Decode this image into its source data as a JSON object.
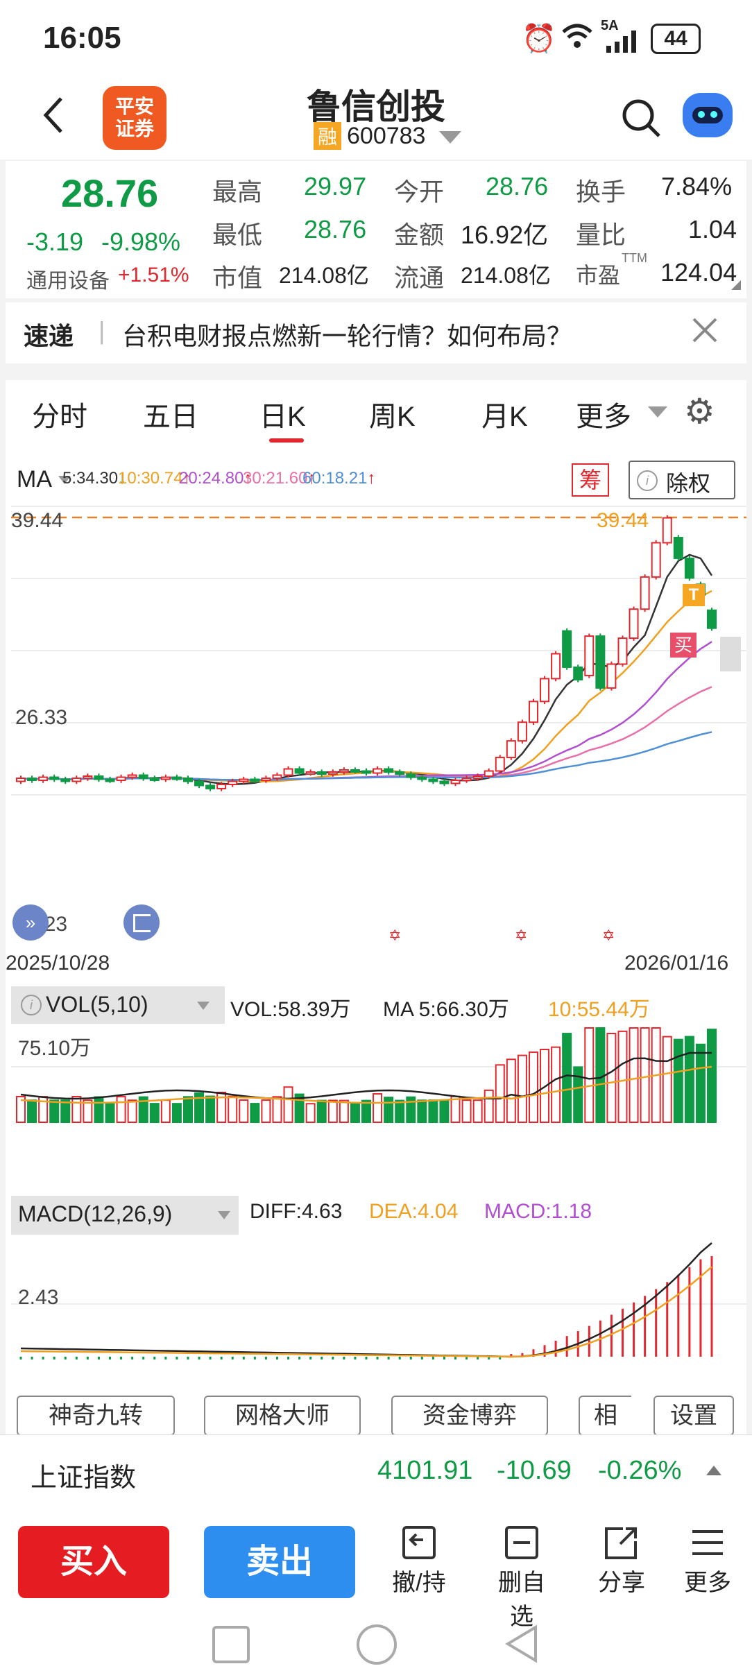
{
  "status_bar": {
    "time": "16:05",
    "battery": "44",
    "network": "5A"
  },
  "header": {
    "title": "鲁信创投",
    "logo_text_1": "平安",
    "logo_text_2": "证券",
    "badge": "融",
    "code": "600783"
  },
  "quote": {
    "price": "28.76",
    "change": "-3.19",
    "change_pct": "-9.98%",
    "sector": "通用设备",
    "sector_change": "+1.51%",
    "fields": [
      {
        "label": "最高",
        "value": "29.97"
      },
      {
        "label": "今开",
        "value": "28.76"
      },
      {
        "label": "换手",
        "value": "7.84%"
      },
      {
        "label": "最低",
        "value": "28.76"
      },
      {
        "label": "金额",
        "value": "16.92亿"
      },
      {
        "label": "量比",
        "value": "1.04"
      },
      {
        "label": "市值",
        "value": "214.08亿"
      },
      {
        "label": "流通",
        "value": "214.08亿"
      },
      {
        "label": "市盈",
        "value": "124.04"
      }
    ],
    "pe_superscript": "TTM"
  },
  "news": {
    "tag": "速递",
    "text": "台积电财报点燃新一轮行情？如何布局？"
  },
  "tabs": [
    "分时",
    "五日",
    "日K",
    "周K",
    "月K",
    "更多"
  ],
  "active_tab": "日K",
  "ma": {
    "label": "MA",
    "items": [
      {
        "text": "5:34.30",
        "color": "#333333"
      },
      {
        "text": "10:30.74",
        "color": "#f0a020"
      },
      {
        "text": "20:24.80",
        "color": "#b04fd0"
      },
      {
        "text": "30:21.60",
        "color": "#e86fa8"
      },
      {
        "text": "60:18.21",
        "color": "#4f8fd6"
      }
    ],
    "chou": "筹",
    "chuquan": "除权"
  },
  "price_axis": {
    "top": "39.44",
    "mid": "26.33",
    "bottom": "13.23",
    "high_marker": "39.44"
  },
  "markers": {
    "t": "T",
    "buy": "买"
  },
  "date_axis": {
    "start": "2025/10/28",
    "end": "2026/01/16"
  },
  "vol": {
    "label": "VOL(5,10)",
    "vol": "VOL:58.39万",
    "ma5": "MA 5:66.30万",
    "ma10": "10:55.44万",
    "axis": "75.10万"
  },
  "macd": {
    "label": "MACD(12,26,9)",
    "diff": "DIFF:4.63",
    "dea": "DEA:4.04",
    "macd": "MACD:1.18",
    "axis": "2.43"
  },
  "tools": [
    "神奇九转",
    "网格大师",
    "资金博弈",
    "相",
    "设置"
  ],
  "index": {
    "name": "上证指数",
    "price": "4101.91",
    "change": "-10.69",
    "pct": "-0.26%"
  },
  "bottom": {
    "buy": "买入",
    "sell": "卖出",
    "actions": [
      "撤/持",
      "删自选",
      "分享",
      "更多"
    ]
  },
  "chart_data": {
    "type": "candlestick",
    "x_range": [
      "2025/10/28",
      "2026/01/16"
    ],
    "y_ticks": [
      39.44,
      26.33,
      13.23
    ],
    "ma_values": {
      "MA5": 34.3,
      "MA10": 30.74,
      "MA20": 24.8,
      "MA30": 21.6,
      "MA60": 18.21
    },
    "candles": [
      {
        "o": 14.0,
        "c": 14.3
      },
      {
        "o": 14.3,
        "c": 14.1
      },
      {
        "o": 14.1,
        "c": 14.4
      },
      {
        "o": 14.4,
        "c": 14.2
      },
      {
        "o": 14.2,
        "c": 14.0
      },
      {
        "o": 14.0,
        "c": 14.3
      },
      {
        "o": 14.3,
        "c": 14.5
      },
      {
        "o": 14.5,
        "c": 14.2
      },
      {
        "o": 14.2,
        "c": 14.1
      },
      {
        "o": 14.1,
        "c": 14.4
      },
      {
        "o": 14.4,
        "c": 14.6
      },
      {
        "o": 14.6,
        "c": 14.3
      },
      {
        "o": 14.3,
        "c": 14.2
      },
      {
        "o": 14.2,
        "c": 14.4
      },
      {
        "o": 14.4,
        "c": 14.3
      },
      {
        "o": 14.3,
        "c": 14.0
      },
      {
        "o": 14.0,
        "c": 13.6
      },
      {
        "o": 13.6,
        "c": 13.3
      },
      {
        "o": 13.3,
        "c": 13.7
      },
      {
        "o": 13.7,
        "c": 14.0
      },
      {
        "o": 14.0,
        "c": 14.2
      },
      {
        "o": 14.2,
        "c": 14.1
      },
      {
        "o": 14.1,
        "c": 14.3
      },
      {
        "o": 14.3,
        "c": 14.6
      },
      {
        "o": 14.6,
        "c": 15.2
      },
      {
        "o": 15.2,
        "c": 14.8
      },
      {
        "o": 14.8,
        "c": 14.9
      },
      {
        "o": 14.9,
        "c": 14.7
      },
      {
        "o": 14.7,
        "c": 14.9
      },
      {
        "o": 14.9,
        "c": 15.1
      },
      {
        "o": 15.1,
        "c": 15.0
      },
      {
        "o": 15.0,
        "c": 14.8
      },
      {
        "o": 14.8,
        "c": 15.2
      },
      {
        "o": 15.2,
        "c": 14.9
      },
      {
        "o": 14.9,
        "c": 14.7
      },
      {
        "o": 14.7,
        "c": 14.4
      },
      {
        "o": 14.4,
        "c": 14.2
      },
      {
        "o": 14.2,
        "c": 14.0
      },
      {
        "o": 14.0,
        "c": 13.8
      },
      {
        "o": 13.8,
        "c": 14.1
      },
      {
        "o": 14.1,
        "c": 14.3
      },
      {
        "o": 14.3,
        "c": 14.5
      },
      {
        "o": 14.5,
        "c": 15.0
      },
      {
        "o": 15.0,
        "c": 16.3
      },
      {
        "o": 16.3,
        "c": 17.9
      },
      {
        "o": 17.9,
        "c": 19.7
      },
      {
        "o": 19.7,
        "c": 21.7
      },
      {
        "o": 21.7,
        "c": 23.9
      },
      {
        "o": 23.9,
        "c": 26.3
      },
      {
        "o": 28.5,
        "c": 25.0
      },
      {
        "o": 25.0,
        "c": 23.8
      },
      {
        "o": 24.2,
        "c": 28.0
      },
      {
        "o": 28.0,
        "c": 23.0
      },
      {
        "o": 23.0,
        "c": 25.3
      },
      {
        "o": 25.3,
        "c": 27.8
      },
      {
        "o": 27.8,
        "c": 30.6
      },
      {
        "o": 30.6,
        "c": 33.7
      },
      {
        "o": 33.7,
        "c": 37.0
      },
      {
        "o": 37.0,
        "c": 39.4
      },
      {
        "o": 37.5,
        "c": 35.5
      },
      {
        "o": 35.5,
        "c": 33.6
      },
      {
        "o": 33.0,
        "c": 31.95
      },
      {
        "o": 30.5,
        "c": 28.76
      }
    ]
  }
}
